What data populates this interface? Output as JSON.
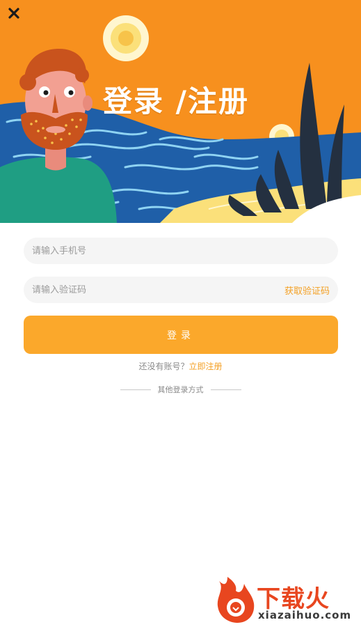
{
  "header": {
    "title": "登录 /注册",
    "close_icon": "close-icon"
  },
  "form": {
    "phone_placeholder": "请输入手机号",
    "phone_value": "",
    "code_placeholder": "请输入验证码",
    "code_value": "",
    "get_code_label": "获取验证码",
    "login_label": "登录"
  },
  "register": {
    "prompt": "还没有账号？",
    "link_label": "立即注册"
  },
  "other_login": {
    "label": "其他登录方式"
  },
  "watermark": {
    "title": "下载火",
    "url": "xiazaihuo.com"
  },
  "colors": {
    "accent": "#fba82b",
    "link": "#f4a024",
    "hero_orange": "#f7901e",
    "hero_blue": "#1f5fa8"
  }
}
